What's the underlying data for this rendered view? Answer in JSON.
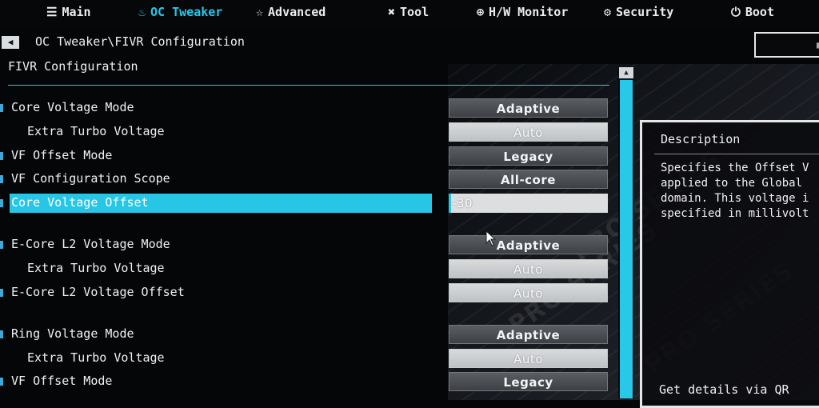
{
  "nav": {
    "tabs": [
      {
        "label": "Main",
        "icon": "list-icon",
        "active": false
      },
      {
        "label": "OC Tweaker",
        "icon": "rocket-icon",
        "active": true
      },
      {
        "label": "Advanced",
        "icon": "star-icon",
        "active": false
      },
      {
        "label": "Tool",
        "icon": "wrench-icon",
        "active": false
      },
      {
        "label": "H/W Monitor",
        "icon": "monitor-icon",
        "active": false
      },
      {
        "label": "Security",
        "icon": "shield-icon",
        "active": false
      },
      {
        "label": "Boot",
        "icon": "power-icon",
        "active": false
      }
    ]
  },
  "breadcrumb": "OC Tweaker\\FIVR Configuration",
  "section_title": "FIVR Configuration",
  "settings": [
    {
      "label": "Core Voltage Mode",
      "value": "Adaptive",
      "style": "dark",
      "sub": false
    },
    {
      "label": "Extra Turbo Voltage",
      "value": "Auto",
      "style": "light",
      "sub": true
    },
    {
      "label": "VF Offset Mode",
      "value": "Legacy",
      "style": "dark",
      "sub": false
    },
    {
      "label": "VF Configuration Scope",
      "value": "All-core",
      "style": "dark",
      "sub": false
    },
    {
      "label": "Core Voltage Offset",
      "value": "-30",
      "style": "input",
      "sub": false,
      "selected": true
    },
    {
      "label": "E-Core L2 Voltage Mode",
      "value": "Adaptive",
      "style": "dark",
      "sub": false
    },
    {
      "label": "Extra Turbo Voltage",
      "value": "Auto",
      "style": "light",
      "sub": true
    },
    {
      "label": "E-Core L2 Voltage Offset",
      "value": "Auto",
      "style": "light",
      "sub": false
    },
    {
      "label": "Ring Voltage Mode",
      "value": "Adaptive",
      "style": "dark",
      "sub": false
    },
    {
      "label": "Extra Turbo Voltage",
      "value": "Auto",
      "style": "light",
      "sub": true
    },
    {
      "label": "VF Offset Mode",
      "value": "Legacy",
      "style": "dark",
      "sub": false
    }
  ],
  "description": {
    "title": "Description",
    "lines": [
      "Specifies the Offset V",
      "applied to the Global",
      "domain. This voltage i",
      "specified in millivolt"
    ],
    "qr_text": "Get details via QR"
  },
  "colors": {
    "accent": "#27c8e8",
    "background": "#050608"
  }
}
